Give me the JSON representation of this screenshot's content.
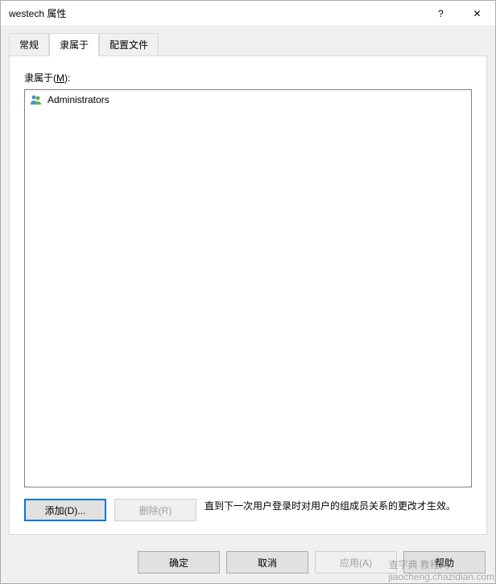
{
  "titlebar": {
    "title": "westech 属性",
    "help": "?",
    "close": "✕"
  },
  "tabs": {
    "general": "常规",
    "memberof": "隶属于",
    "profile": "配置文件"
  },
  "panel": {
    "section_label_prefix": "隶属于(",
    "section_label_key": "M",
    "section_label_suffix": "):",
    "items": [
      {
        "name": "Administrators"
      }
    ],
    "add_label": "添加(D)...",
    "remove_label": "删除(R)",
    "hint": "直到下一次用户登录时对用户的组成员关系的更改才生效。"
  },
  "buttons": {
    "ok": "确定",
    "cancel": "取消",
    "apply": "应用(A)",
    "help": "帮助"
  },
  "watermark": {
    "line1": "查字典 教程网",
    "line2": "jiaocheng.chazidian.com"
  }
}
